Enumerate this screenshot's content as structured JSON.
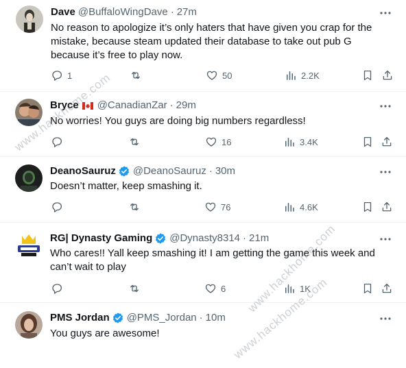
{
  "tweets": [
    {
      "name": "Dave",
      "handle": "@BuffaloWingDave",
      "dot": "·",
      "time": "27m",
      "text": "No reason to apologize it’s only haters that have given you crap for the mistake, because steam updated their database to take out pub G because it’s free to play now.",
      "reply_count": "1",
      "retweet_count": "",
      "like_count": "50",
      "view_count": "2.2K"
    },
    {
      "name": "Bryce",
      "flag": "canada-flag-icon",
      "handle": "@CanadianZar",
      "dot": "·",
      "time": "29m",
      "text": "No worries! You guys are doing big numbers regardless!",
      "reply_count": "",
      "retweet_count": "",
      "like_count": "16",
      "view_count": "3.4K"
    },
    {
      "name": "DeanoSauruz",
      "verified": true,
      "handle": "@DeanoSauruz",
      "dot": "·",
      "time": "30m",
      "text": "Doesn’t matter, keep smashing it.",
      "reply_count": "",
      "retweet_count": "",
      "like_count": "76",
      "view_count": "4.6K"
    },
    {
      "name": "RG| Dynasty Gaming",
      "verified": true,
      "handle": "@Dynasty8314",
      "dot": "·",
      "time": "21m",
      "text": "Who cares!! Yall keep smashing it!  I am getting the game this week and can’t wait to play",
      "reply_count": "",
      "retweet_count": "",
      "like_count": "6",
      "view_count": "1K"
    },
    {
      "name": "PMS Jordan",
      "verified": true,
      "handle": "@PMS_Jordan",
      "dot": "·",
      "time": "10m",
      "text": "You guys are awesome!"
    }
  ],
  "watermarks": [
    "www.hackhome.com",
    "www.hackhome.com",
    "www.hackhome.com"
  ],
  "colors": {
    "text": "#0f1419",
    "secondary": "#536471",
    "verified": "#1d9bf0",
    "separator": "#eff3f4"
  }
}
